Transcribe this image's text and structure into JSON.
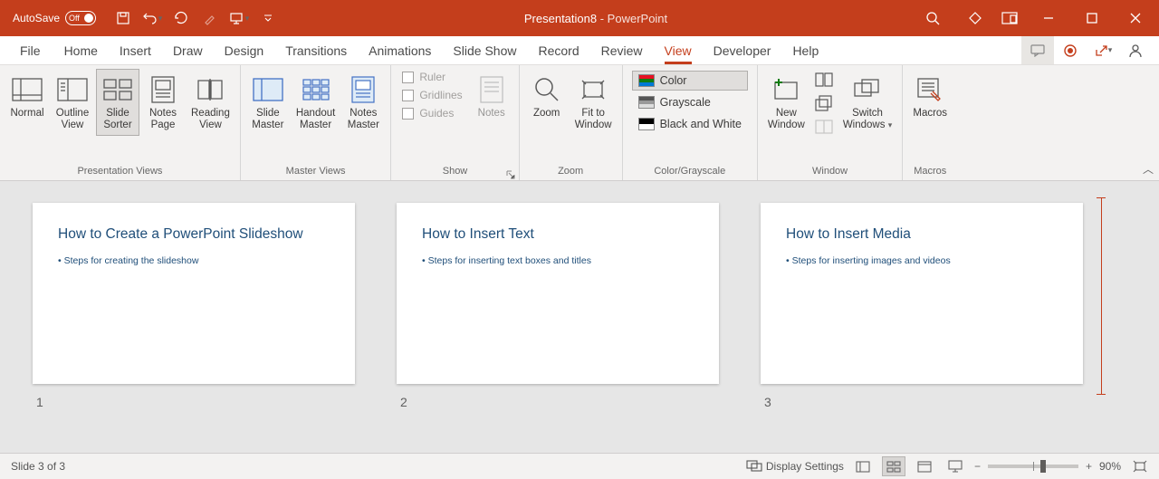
{
  "title": {
    "autosave_label": "AutoSave",
    "autosave_state": "Off",
    "doc": "Presentation8",
    "app": "PowerPoint"
  },
  "tabs": {
    "file": "File",
    "home": "Home",
    "insert": "Insert",
    "draw": "Draw",
    "design": "Design",
    "transitions": "Transitions",
    "animations": "Animations",
    "slideshow": "Slide Show",
    "record": "Record",
    "review": "Review",
    "view": "View",
    "developer": "Developer",
    "help": "Help"
  },
  "ribbon": {
    "presentation_views": {
      "label": "Presentation Views",
      "normal": "Normal",
      "outline": "Outline\nView",
      "sorter": "Slide\nSorter",
      "notes_page": "Notes\nPage",
      "reading": "Reading\nView"
    },
    "master_views": {
      "label": "Master Views",
      "slide_master": "Slide\nMaster",
      "handout_master": "Handout\nMaster",
      "notes_master": "Notes\nMaster"
    },
    "show": {
      "label": "Show",
      "ruler": "Ruler",
      "gridlines": "Gridlines",
      "guides": "Guides",
      "notes": "Notes"
    },
    "zoom": {
      "label": "Zoom",
      "zoom": "Zoom",
      "fit": "Fit to\nWindow"
    },
    "color": {
      "label": "Color/Grayscale",
      "color": "Color",
      "gray": "Grayscale",
      "bw": "Black and White"
    },
    "window": {
      "label": "Window",
      "new": "New\nWindow",
      "switch": "Switch\nWindows"
    },
    "macros": {
      "label": "Macros",
      "macros": "Macros"
    }
  },
  "slides": [
    {
      "num": "1",
      "title": "How to Create a PowerPoint Slideshow",
      "bullet": "Steps for creating the slideshow"
    },
    {
      "num": "2",
      "title": "How to Insert Text",
      "bullet": "Steps for inserting text boxes and titles"
    },
    {
      "num": "3",
      "title": "How to Insert Media",
      "bullet": "Steps for inserting images and videos"
    }
  ],
  "status": {
    "left": "Slide 3 of 3",
    "display": "Display Settings",
    "zoom": "90%"
  }
}
